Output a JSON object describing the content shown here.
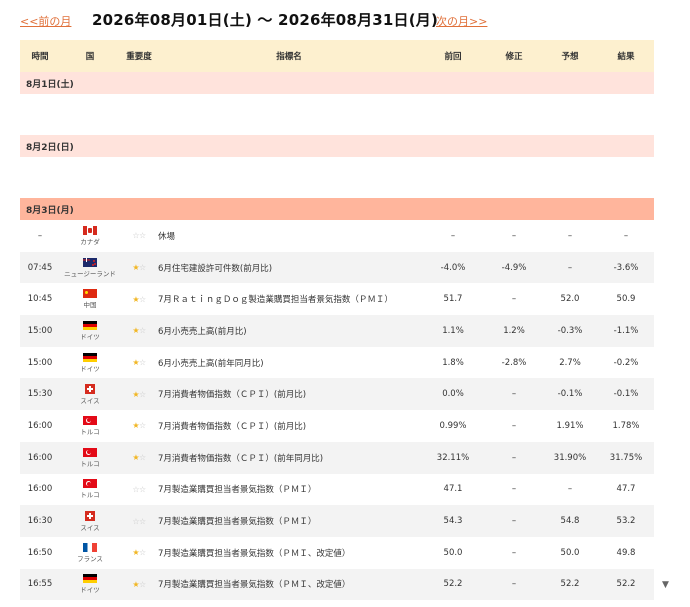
{
  "nav": {
    "prev_label": "<<前の月",
    "range_label": "2026年08月01日(土) 〜 2026年08月31日(月)",
    "next_label": "次の月>>"
  },
  "header": {
    "time": "時間",
    "country": "国",
    "importance": "重要度",
    "indicator": "指標名",
    "previous": "前回",
    "revised": "修正",
    "forecast": "予想",
    "result": "結果"
  },
  "days": [
    {
      "label": "8月1日(土)",
      "style": "light",
      "rows": []
    },
    {
      "label": "8月2日(日)",
      "style": "light",
      "rows": []
    },
    {
      "label": "8月3日(月)",
      "style": "dark",
      "rows": [
        {
          "time": "–",
          "country": "カナダ",
          "flag": "ca",
          "stars": 0,
          "name": "休場",
          "previous": "–",
          "revised": "–",
          "forecast": "–",
          "result": "–"
        },
        {
          "time": "07:45",
          "country": "ニュージーランド",
          "flag": "nz",
          "stars": 1,
          "name": "6月住宅建設許可件数(前月比)",
          "previous": "-4.0%",
          "revised": "-4.9%",
          "forecast": "–",
          "result": "-3.6%"
        },
        {
          "time": "10:45",
          "country": "中国",
          "flag": "cn",
          "stars": 1,
          "name": "7月ＲａｔｉｎｇＤｏｇ製造業購買担当者景気指数（ＰＭＩ）",
          "previous": "51.7",
          "revised": "–",
          "forecast": "52.0",
          "result": "50.9"
        },
        {
          "time": "15:00",
          "country": "ドイツ",
          "flag": "de",
          "stars": 1,
          "name": "6月小売売上高(前月比)",
          "previous": "1.1%",
          "revised": "1.2%",
          "forecast": "-0.3%",
          "result": "-1.1%"
        },
        {
          "time": "15:00",
          "country": "ドイツ",
          "flag": "de",
          "stars": 1,
          "name": "6月小売売上高(前年同月比)",
          "previous": "1.8%",
          "revised": "-2.8%",
          "forecast": "2.7%",
          "result": "-0.2%"
        },
        {
          "time": "15:30",
          "country": "スイス",
          "flag": "ch",
          "stars": 1,
          "name": "7月消費者物価指数（ＣＰＩ）(前月比)",
          "previous": "0.0%",
          "revised": "–",
          "forecast": "-0.1%",
          "result": "-0.1%"
        },
        {
          "time": "16:00",
          "country": "トルコ",
          "flag": "tr",
          "stars": 1,
          "name": "7月消費者物価指数（ＣＰＩ）(前月比)",
          "previous": "0.99%",
          "revised": "–",
          "forecast": "1.91%",
          "result": "1.78%"
        },
        {
          "time": "16:00",
          "country": "トルコ",
          "flag": "tr",
          "stars": 1,
          "name": "7月消費者物価指数（ＣＰＩ）(前年同月比)",
          "previous": "32.11%",
          "revised": "–",
          "forecast": "31.90%",
          "result": "31.75%"
        },
        {
          "time": "16:00",
          "country": "トルコ",
          "flag": "tr",
          "stars": 0,
          "name": "7月製造業購買担当者景気指数（ＰＭＩ）",
          "previous": "47.1",
          "revised": "–",
          "forecast": "–",
          "result": "47.7"
        },
        {
          "time": "16:30",
          "country": "スイス",
          "flag": "ch",
          "stars": 0,
          "name": "7月製造業購買担当者景気指数（ＰＭＩ）",
          "previous": "54.3",
          "revised": "–",
          "forecast": "54.8",
          "result": "53.2"
        },
        {
          "time": "16:50",
          "country": "フランス",
          "flag": "fr",
          "stars": 1,
          "name": "7月製造業購買担当者景気指数（ＰＭＩ、改定値）",
          "previous": "50.0",
          "revised": "–",
          "forecast": "50.0",
          "result": "49.8"
        },
        {
          "time": "16:55",
          "country": "ドイツ",
          "flag": "de",
          "stars": 1,
          "name": "7月製造業購買担当者景気指数（ＰＭＩ、改定値）",
          "previous": "52.2",
          "revised": "–",
          "forecast": "52.2",
          "result": "52.2"
        }
      ]
    }
  ],
  "colors": {
    "header_bg": "#fdf0cf",
    "date_light": "#ffe3dc",
    "date_dark": "#ffb59c",
    "link": "#e0703a",
    "star_on": "#f1b623",
    "star_off": "#c8c8c8"
  },
  "icons": {
    "star": "★",
    "star_empty": "☆",
    "scroll_down": "▼"
  }
}
